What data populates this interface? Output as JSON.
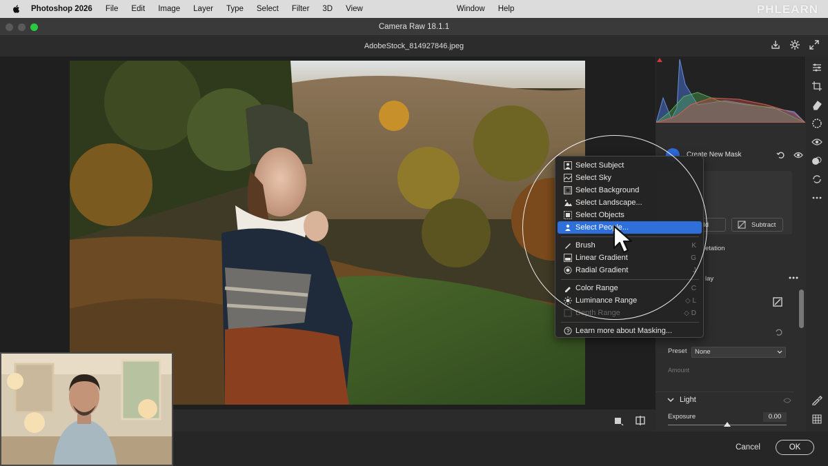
{
  "menubar": {
    "app_name": "Photoshop 2026",
    "items": [
      "File",
      "Edit",
      "Image",
      "Layer",
      "Type",
      "Select",
      "Filter",
      "3D",
      "View",
      "Window",
      "Help"
    ],
    "watermark": "PHLEARN"
  },
  "window": {
    "title": "Camera Raw 18.1.1"
  },
  "document": {
    "filename": "AdobeStock_814927846.jpeg"
  },
  "masking_panel": {
    "create_label": "Create New Mask",
    "add_fragment": "dd",
    "subtract_label": "Subtract",
    "interpretation_fragment": "etation",
    "overlay_fragment": "lay"
  },
  "properties": {
    "preset_label": "Preset",
    "preset_value": "None",
    "amount_label": "Amount",
    "light_label": "Light",
    "exposure_label": "Exposure",
    "exposure_value": "0.00"
  },
  "popup_menu": {
    "items": [
      {
        "label": "Select Subject",
        "icon": "person-icon",
        "shortcut": ""
      },
      {
        "label": "Select Sky",
        "icon": "sky-icon",
        "shortcut": ""
      },
      {
        "label": "Select Background",
        "icon": "background-icon",
        "shortcut": ""
      },
      {
        "label": "Select Landscape...",
        "icon": "landscape-icon",
        "shortcut": ""
      },
      {
        "label": "Select Objects",
        "icon": "objects-icon",
        "shortcut": ""
      },
      {
        "label": "Select People...",
        "icon": "people-icon",
        "shortcut": "",
        "highlighted": true
      },
      {
        "label": "Brush",
        "icon": "brush-icon",
        "shortcut": "K"
      },
      {
        "label": "Linear Gradient",
        "icon": "linear-gradient-icon",
        "shortcut": "G"
      },
      {
        "label": "Radial Gradient",
        "icon": "radial-gradient-icon",
        "shortcut": "J"
      },
      {
        "label": "Color Range",
        "icon": "color-range-icon",
        "shortcut": "C"
      },
      {
        "label": "Luminance Range",
        "icon": "luminance-range-icon",
        "shortcut": "◇ L"
      },
      {
        "label": "Depth Range",
        "icon": "depth-range-icon",
        "shortcut": "◇ D",
        "disabled": true
      },
      {
        "label": "Learn more about Masking...",
        "icon": "help-icon",
        "shortcut": ""
      }
    ]
  },
  "footer": {
    "cancel_label": "Cancel",
    "ok_label": "OK"
  },
  "colors": {
    "accent": "#2e6fd9",
    "panel": "#2d2d2d",
    "menubar": "#dcdcdc"
  }
}
